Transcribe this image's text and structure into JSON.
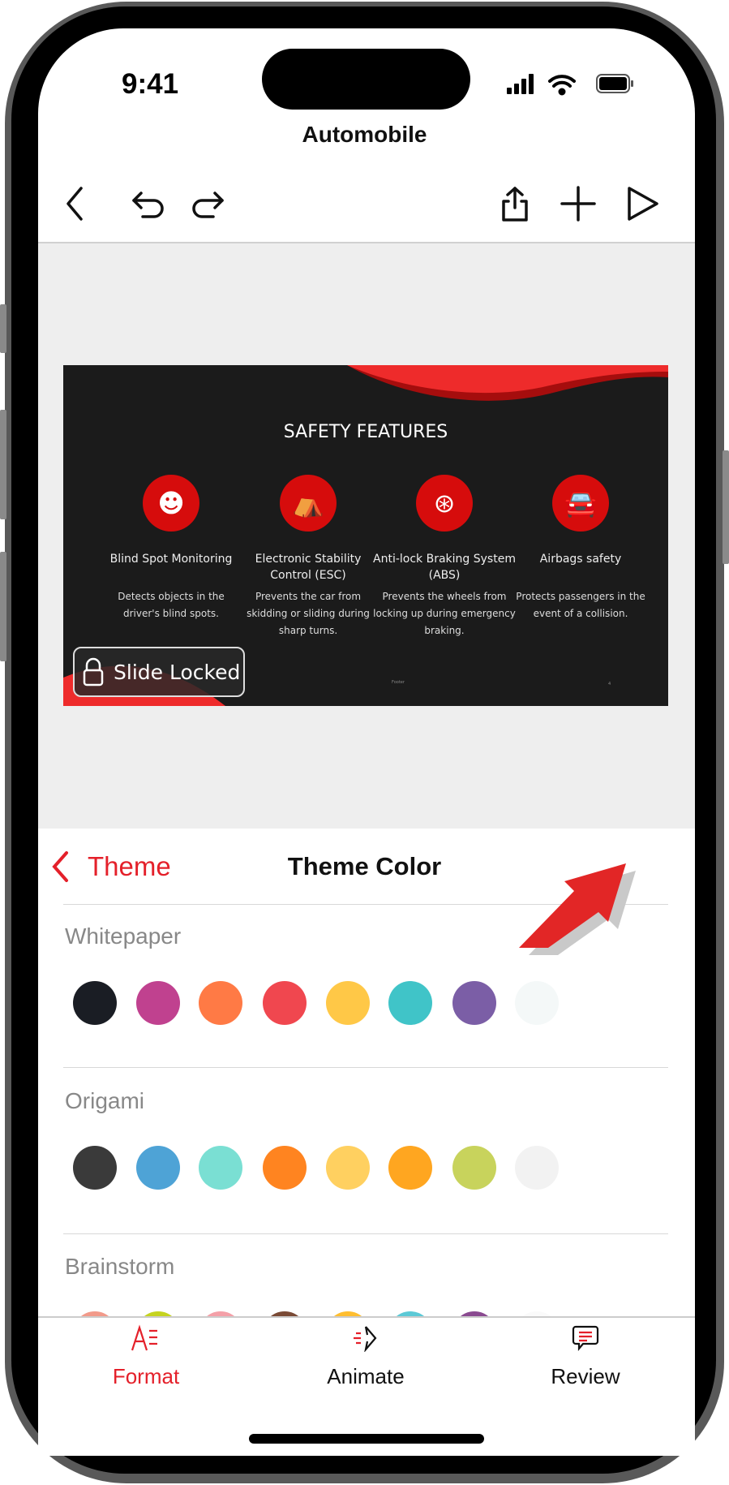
{
  "status_bar": {
    "time": "9:41"
  },
  "document": {
    "title": "Automobile"
  },
  "toolbar": {
    "icons": [
      "back-chevron-icon",
      "undo-icon",
      "redo-icon",
      "share-icon",
      "add-icon",
      "play-icon"
    ]
  },
  "slide": {
    "title": "SAFETY FEATURES",
    "features": [
      {
        "icon": "airbag-person-icon",
        "heading": "Blind Spot Monitoring",
        "description": "Detects objects in the driver's blind spots."
      },
      {
        "icon": "car-seat-icon",
        "heading": "Electronic Stability Control (ESC)",
        "description": "Prevents the car from skidding or sliding during sharp turns."
      },
      {
        "icon": "brake-disc-icon",
        "heading": "Anti-lock Braking System (ABS)",
        "description": "Prevents the wheels from locking up during emergency braking."
      },
      {
        "icon": "car-crash-icon",
        "heading": "Airbags safety",
        "description": "Protects passengers in the event of a collision."
      }
    ],
    "footer": "Footer",
    "page_number": "4",
    "lock_badge": "Slide Locked",
    "accent": "#e52b2b"
  },
  "panel": {
    "back_label": "Theme",
    "title": "Theme Color",
    "themes": [
      {
        "name": "Whitepaper",
        "colors": [
          "#1a1d24",
          "#c0418f",
          "#ff7a45",
          "#f0474f",
          "#ffc847",
          "#40c4c8",
          "#7b5ea6",
          "#f4f8f8"
        ]
      },
      {
        "name": "Origami",
        "colors": [
          "#3a3a3a",
          "#4ea3d6",
          "#7adfd3",
          "#ff8420",
          "#ffd060",
          "#ffa620",
          "#c8d35c",
          "#f2f2f2"
        ]
      },
      {
        "name": "Brainstorm",
        "colors": [
          "#f29a8a",
          "#c5d320",
          "#f4a0a8",
          "#7a4a35",
          "#ffbe30",
          "#5cc9d6",
          "#8a4a90",
          "#fafafa"
        ]
      }
    ]
  },
  "tabs": [
    {
      "label": "Format",
      "active": true
    },
    {
      "label": "Animate",
      "active": false
    },
    {
      "label": "Review",
      "active": false
    }
  ],
  "colors": {
    "accent": "#e4202a"
  }
}
